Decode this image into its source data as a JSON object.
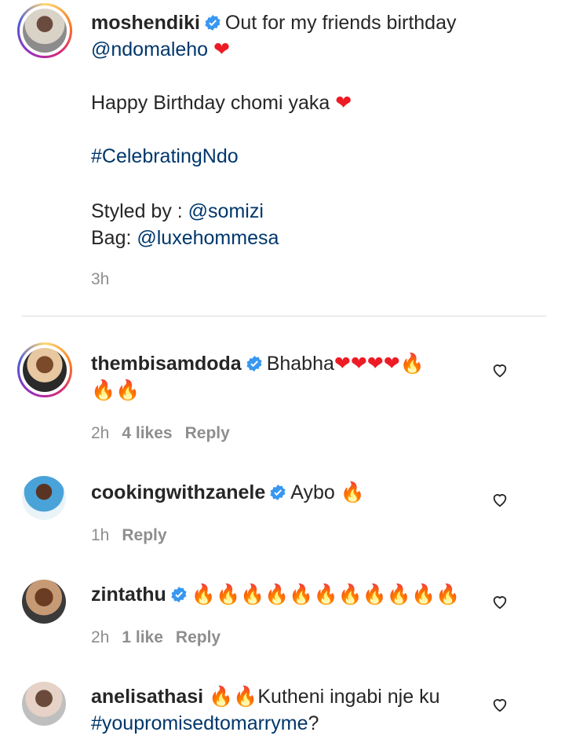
{
  "caption": {
    "username": "moshendiki",
    "text_1": "Out for my friends birthday",
    "mention_1": "@ndomaleho",
    "line_2": "Happy Birthday chomi yaka",
    "hashtag": "#CelebratingNdo",
    "styled_label": "Styled by : ",
    "styled_mention": "@somizi",
    "bag_label": "Bag: ",
    "bag_mention": "@luxehommesa",
    "time": "3h"
  },
  "comments": [
    {
      "username": "thembisamdoda",
      "text": "Bhabha",
      "time": "2h",
      "likes": "4 likes",
      "reply": "Reply"
    },
    {
      "username": "cookingwithzanele",
      "text": "Aybo",
      "time": "1h",
      "reply": "Reply"
    },
    {
      "username": "zintathu",
      "time": "2h",
      "likes": "1 like",
      "reply": "Reply"
    },
    {
      "username": "anelisathasi",
      "text": "Kutheni ingabi nje ku",
      "hashtag": "#youpromisedtomarryme",
      "suffix": "?"
    }
  ],
  "icons": {
    "verified": "verified-badge-icon",
    "like": "heart-outline-icon"
  },
  "colors": {
    "link": "#00376b",
    "verified": "#3897f0",
    "meta": "#8e8e8e"
  }
}
